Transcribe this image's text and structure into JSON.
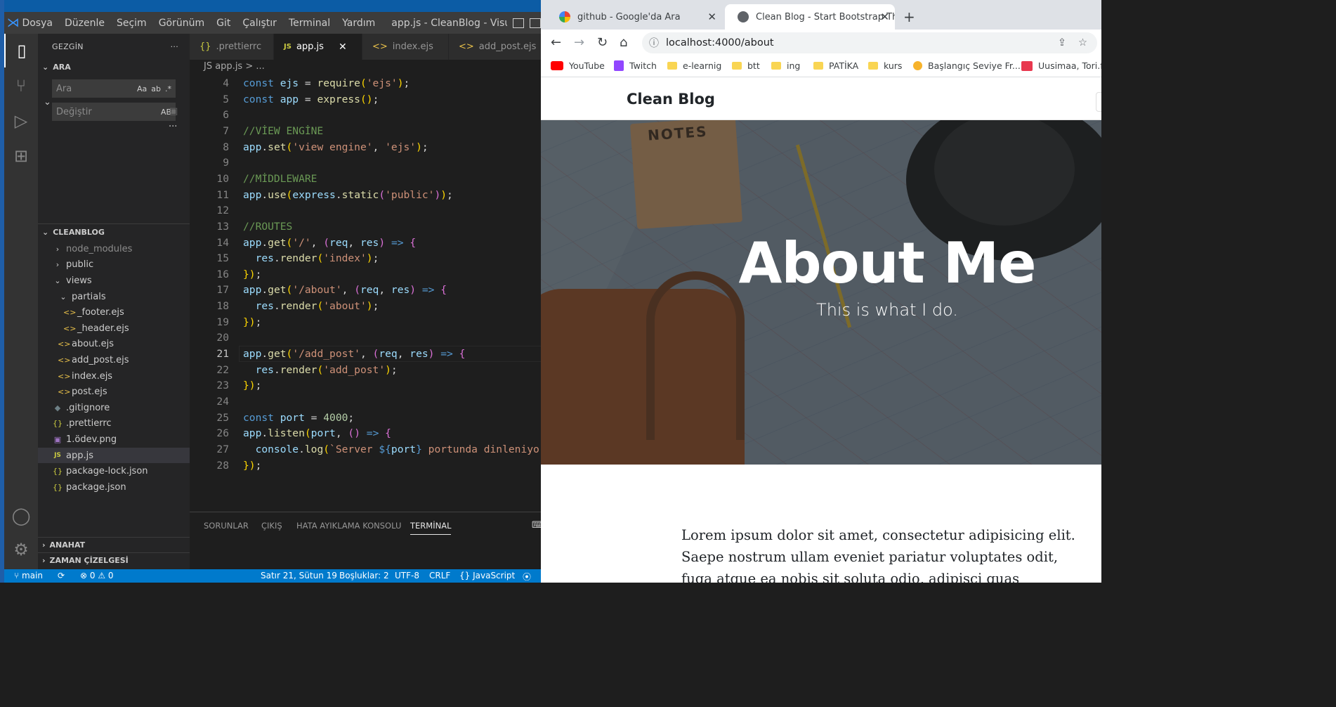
{
  "vscode": {
    "menu": [
      "Dosya",
      "Düzenle",
      "Seçim",
      "Görünüm",
      "Git",
      "Çalıştır",
      "Terminal",
      "Yardım"
    ],
    "window_title": "app.js - CleanBlog - Visual Studio C...",
    "sidebar": {
      "title": "GEZGİN",
      "search_section": "ARA",
      "search_placeholder": "Ara",
      "search_opt_case": "Aa",
      "search_opt_word": "ab",
      "search_opt_regex": ".*",
      "replace_placeholder": "Değiştir",
      "replace_opt": "AB",
      "project": "CLEANBLOG",
      "tree": [
        {
          "label": "node_modules",
          "type": "folder",
          "depth": 0,
          "open": false,
          "dim": true
        },
        {
          "label": "public",
          "type": "folder",
          "depth": 0,
          "open": false
        },
        {
          "label": "views",
          "type": "folder",
          "depth": 0,
          "open": true
        },
        {
          "label": "partials",
          "type": "folder",
          "depth": 1,
          "open": true
        },
        {
          "label": "_footer.ejs",
          "type": "ejs",
          "depth": 2
        },
        {
          "label": "_header.ejs",
          "type": "ejs",
          "depth": 2
        },
        {
          "label": "about.ejs",
          "type": "ejs",
          "depth": 1
        },
        {
          "label": "add_post.ejs",
          "type": "ejs",
          "depth": 1
        },
        {
          "label": "index.ejs",
          "type": "ejs",
          "depth": 1
        },
        {
          "label": "post.ejs",
          "type": "ejs",
          "depth": 1
        },
        {
          "label": ".gitignore",
          "type": "git",
          "depth": 0
        },
        {
          "label": ".prettierrc",
          "type": "json",
          "depth": 0
        },
        {
          "label": "1.ödev.png",
          "type": "png",
          "depth": 0
        },
        {
          "label": "app.js",
          "type": "js",
          "depth": 0,
          "selected": true
        },
        {
          "label": "package-lock.json",
          "type": "json",
          "depth": 0
        },
        {
          "label": "package.json",
          "type": "json",
          "depth": 0
        }
      ],
      "outline": "ANAHAT",
      "timeline": "ZAMAN ÇİZELGESİ"
    },
    "tabs": [
      {
        "label": ".prettierrc",
        "icon": "{}"
      },
      {
        "label": "app.js",
        "icon": "JS",
        "active": true
      },
      {
        "label": "index.ejs",
        "icon": "<>"
      },
      {
        "label": "add_post.ejs",
        "icon": "<>"
      }
    ],
    "breadcrumb": "JS app.js > ...",
    "current_line": 21,
    "code": [
      {
        "n": 4,
        "t": "const ejs = require('ejs');"
      },
      {
        "n": 5,
        "t": "const app = express();"
      },
      {
        "n": 6,
        "t": ""
      },
      {
        "n": 7,
        "t": "//VİEW ENGİNE"
      },
      {
        "n": 8,
        "t": "app.set('view engine', 'ejs');"
      },
      {
        "n": 9,
        "t": ""
      },
      {
        "n": 10,
        "t": "//MİDDLEWARE"
      },
      {
        "n": 11,
        "t": "app.use(express.static('public'));"
      },
      {
        "n": 12,
        "t": ""
      },
      {
        "n": 13,
        "t": "//ROUTES"
      },
      {
        "n": 14,
        "t": "app.get('/', (req, res) => {"
      },
      {
        "n": 15,
        "t": "  res.render('index');"
      },
      {
        "n": 16,
        "t": "});"
      },
      {
        "n": 17,
        "t": "app.get('/about', (req, res) => {"
      },
      {
        "n": 18,
        "t": "  res.render('about');"
      },
      {
        "n": 19,
        "t": "});"
      },
      {
        "n": 20,
        "t": ""
      },
      {
        "n": 21,
        "t": "app.get('/add_post', (req, res) => {"
      },
      {
        "n": 22,
        "t": "  res.render('add_post');"
      },
      {
        "n": 23,
        "t": "});"
      },
      {
        "n": 24,
        "t": ""
      },
      {
        "n": 25,
        "t": "const port = 4000;"
      },
      {
        "n": 26,
        "t": "app.listen(port, () => {"
      },
      {
        "n": 27,
        "t": "  console.log(`Server ${port} portunda dinleniyo"
      },
      {
        "n": 28,
        "t": "});"
      }
    ],
    "panel_tabs": [
      "SORUNLAR",
      "ÇIKIŞ",
      "HATA AYIKLAMA KONSOLU",
      "TERMİNAL"
    ],
    "status": {
      "branch": "main",
      "errors": "0",
      "warnings": "0",
      "position": "Satır 21, Sütun 19",
      "spaces": "Boşluklar: 2",
      "encoding": "UTF-8",
      "eol": "CRLF",
      "language": "JavaScript"
    }
  },
  "chrome": {
    "tabs": [
      {
        "label": "github - Google'da Ara"
      },
      {
        "label": "Clean Blog - Start Bootstrap Ther",
        "active": true
      }
    ],
    "url": "localhost:4000/about",
    "bookmarks": [
      "YouTube",
      "Twitch",
      "e-learnig",
      "btt",
      "ing",
      "PATİKA",
      "kurs",
      "Başlangıç Seviye Fr...",
      "Uusimaa, Tori.fi"
    ],
    "page": {
      "brand": "Clean Blog",
      "hero_title": "About Me",
      "hero_subtitle": "This is what I do.",
      "notebook_text": "NOTES",
      "body": "Lorem ipsum dolor sit amet, consectetur adipisicing elit. Saepe nostrum ullam eveniet pariatur voluptates odit, fuga atque ea nobis sit soluta odio, adipisci quas excepturi"
    }
  }
}
